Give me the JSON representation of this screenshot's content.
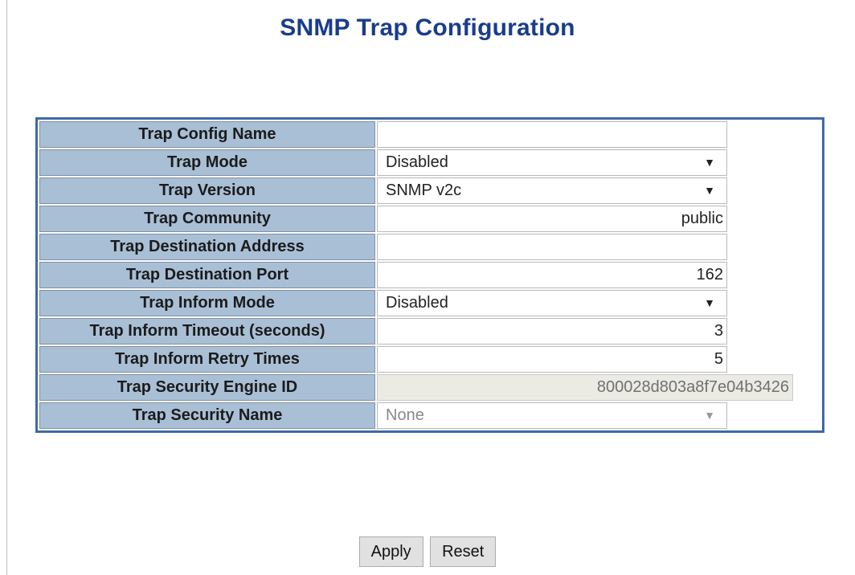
{
  "page": {
    "title": "SNMP Trap Configuration"
  },
  "fields": {
    "config_name": {
      "label": "Trap Config Name",
      "value": ""
    },
    "mode": {
      "label": "Trap Mode",
      "value": "Disabled"
    },
    "version": {
      "label": "Trap Version",
      "value": "SNMP v2c"
    },
    "community": {
      "label": "Trap Community",
      "value": "public"
    },
    "dest_address": {
      "label": "Trap Destination Address",
      "value": ""
    },
    "dest_port": {
      "label": "Trap Destination Port",
      "value": "162"
    },
    "inform_mode": {
      "label": "Trap Inform Mode",
      "value": "Disabled"
    },
    "inform_timeout": {
      "label": "Trap Inform Timeout (seconds)",
      "value": "3"
    },
    "inform_retry": {
      "label": "Trap Inform Retry Times",
      "value": "5"
    },
    "engine_id": {
      "label": "Trap Security Engine ID",
      "value": "800028d803a8f7e04b3426"
    },
    "security_name": {
      "label": "Trap Security Name",
      "value": "None"
    }
  },
  "buttons": {
    "apply": "Apply",
    "reset": "Reset"
  },
  "icons": {
    "dropdown": "dropdown-arrow-icon"
  },
  "colors": {
    "title": "#1a3c8e",
    "label_bg": "#a9bfd6",
    "table_border": "#3d6aa8"
  }
}
